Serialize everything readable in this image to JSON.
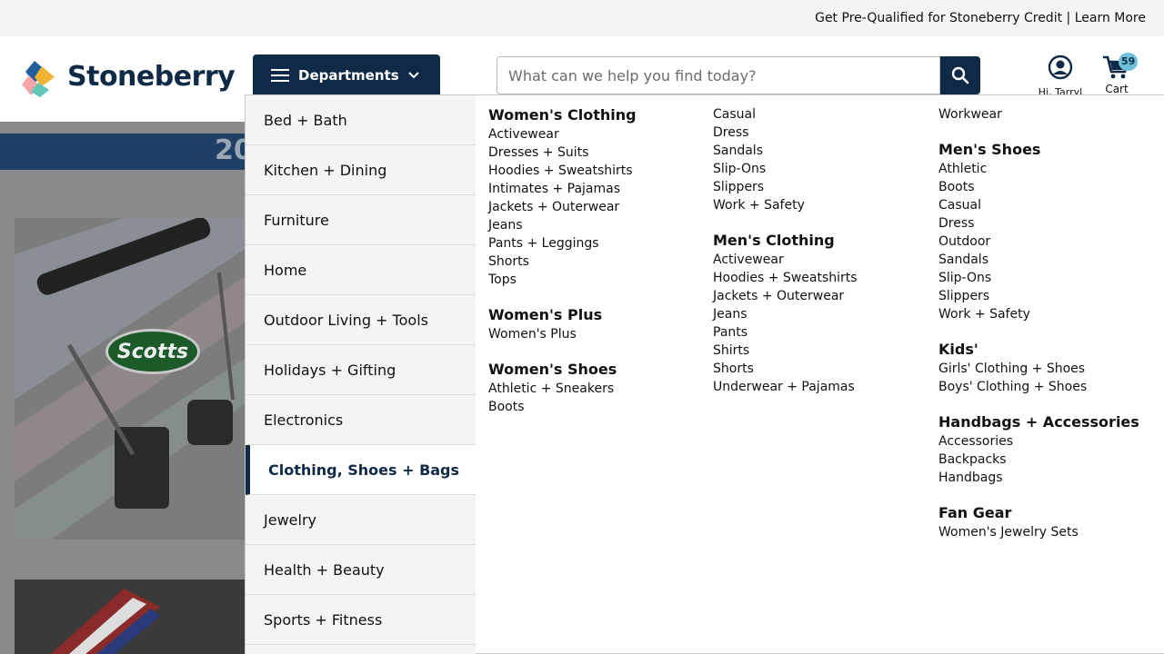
{
  "topbar": {
    "prequal": "Get Pre-Qualified for Stoneberry Credit",
    "sep": " | ",
    "learn_more": "Learn More"
  },
  "header": {
    "logo_text": "Stoneberry",
    "departments_label": "Departments",
    "search_placeholder": "What can we help you find today?",
    "account_label": "Hi, Tarryl",
    "cart_label": "Cart",
    "cart_count": "59"
  },
  "background": {
    "year_fragment": "20",
    "promo_brand": "Scotts"
  },
  "colors": {
    "navy": "#0e2a47",
    "badge": "#6ec1d8"
  },
  "menu": {
    "categories": [
      "Bed + Bath",
      "Kitchen + Dining",
      "Furniture",
      "Home",
      "Outdoor Living + Tools",
      "Holidays + Gifting",
      "Electronics",
      "Clothing, Shoes + Bags",
      "Jewelry",
      "Health + Beauty",
      "Sports + Fitness"
    ],
    "active_category": "Clothing, Shoes + Bags",
    "col1": [
      {
        "title": "Women's Clothing",
        "items": [
          "Activewear",
          "Dresses + Suits",
          "Hoodies + Sweatshirts",
          "Intimates + Pajamas",
          "Jackets + Outerwear",
          "Jeans",
          "Pants + Leggings",
          "Shorts",
          "Tops"
        ]
      },
      {
        "title": "Women's Plus",
        "items": [
          "Women's Plus"
        ]
      },
      {
        "title": "Women's Shoes",
        "items": [
          "Athletic + Sneakers",
          "Boots"
        ]
      }
    ],
    "col2": [
      {
        "title": "",
        "items": [
          "Casual",
          "Dress",
          "Sandals",
          "Slip-Ons",
          "Slippers",
          "Work + Safety"
        ]
      },
      {
        "title": "Men's Clothing",
        "items": [
          "Activewear",
          "Hoodies + Sweatshirts",
          "Jackets + Outerwear",
          "Jeans",
          "Pants",
          "Shirts",
          "Shorts",
          "Underwear + Pajamas"
        ]
      }
    ],
    "col3": [
      {
        "title": "",
        "items": [
          "Workwear"
        ]
      },
      {
        "title": "Men's Shoes",
        "items": [
          "Athletic",
          "Boots",
          "Casual",
          "Dress",
          "Outdoor",
          "Sandals",
          "Slip-Ons",
          "Slippers",
          "Work + Safety"
        ]
      },
      {
        "title": "Kids'",
        "items": [
          "Girls' Clothing + Shoes",
          "Boys' Clothing + Shoes"
        ]
      },
      {
        "title": "Handbags + Accessories",
        "items": [
          "Accessories",
          "Backpacks",
          "Handbags"
        ]
      },
      {
        "title": "Fan Gear",
        "items": [
          "Women's Jewelry Sets"
        ]
      }
    ]
  }
}
